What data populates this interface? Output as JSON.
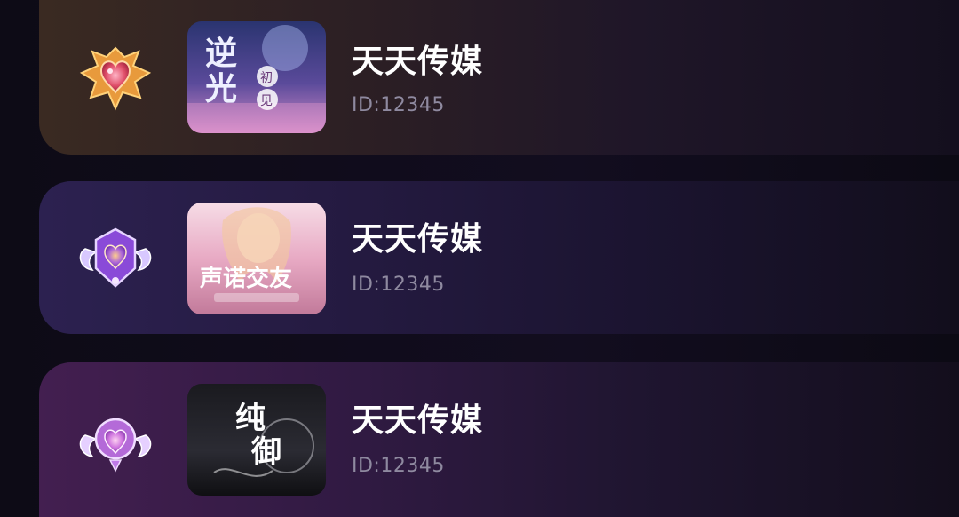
{
  "list": [
    {
      "title": "天天传媒",
      "id_text": "ID:12345",
      "badge_icon": "gold-heart-crest-icon",
      "cover_text": [
        "逆",
        "光",
        "初",
        "见"
      ],
      "cover_theme": "blue-purple-night"
    },
    {
      "title": "天天传媒",
      "id_text": "ID:12345",
      "badge_icon": "purple-winged-heart-icon",
      "cover_text": [
        "声",
        "诺",
        "交",
        "友"
      ],
      "cover_theme": "pink-fairy"
    },
    {
      "title": "天天传媒",
      "id_text": "ID:12345",
      "badge_icon": "violet-winged-heart-icon",
      "cover_text": [
        "纯",
        "御"
      ],
      "cover_theme": "black-white"
    }
  ],
  "colors": {
    "title": "#ffffff",
    "id": "#8f8aa0",
    "card1": "#3a2a22",
    "card2": "#2c2150",
    "card3": "#431f50"
  }
}
